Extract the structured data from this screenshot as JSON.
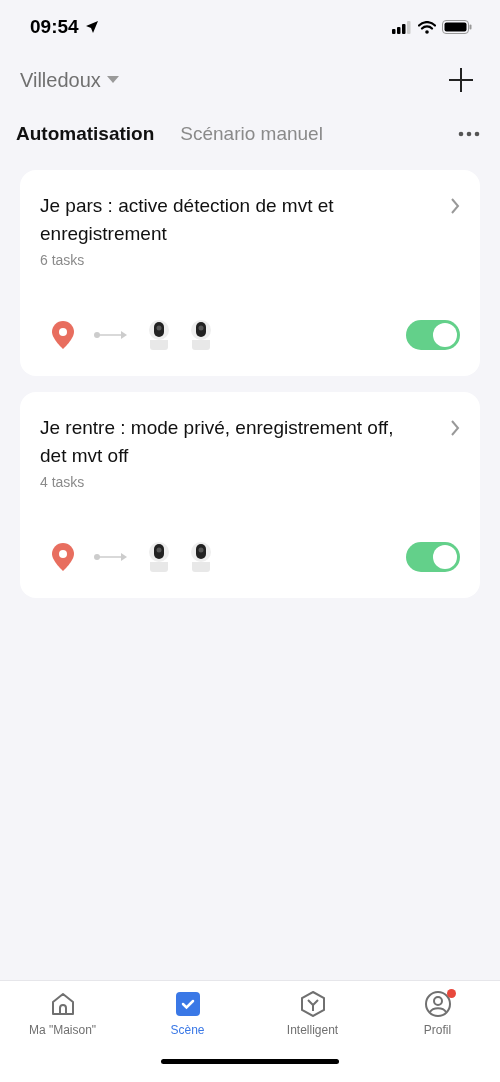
{
  "status_bar": {
    "time": "09:54"
  },
  "header": {
    "home": "Villedoux"
  },
  "tabs": [
    {
      "label": "Automatisation",
      "selected": true
    },
    {
      "label": "Scénario manuel",
      "selected": false
    }
  ],
  "scenes": [
    {
      "title": "Je pars : active détection de mvt et enregistrement",
      "tasks": "6 tasks",
      "on": true,
      "trigger": {
        "kind": "location"
      },
      "actions": [
        {
          "kind": "camera"
        },
        {
          "kind": "camera"
        }
      ]
    },
    {
      "title": "Je rentre : mode privé, enregistrement off, det mvt off",
      "tasks": "4 tasks",
      "on": true,
      "trigger": {
        "kind": "location"
      },
      "actions": [
        {
          "kind": "camera"
        },
        {
          "kind": "camera"
        }
      ]
    }
  ],
  "nav": [
    {
      "kind": "home",
      "label": "Ma \"Maison\"",
      "selected": false,
      "badge": false
    },
    {
      "kind": "scene",
      "label": "Scène",
      "selected": true,
      "badge": false
    },
    {
      "kind": "smart",
      "label": "Intelligent",
      "selected": false,
      "badge": false
    },
    {
      "kind": "profile",
      "label": "Profil",
      "selected": false,
      "badge": true
    }
  ]
}
